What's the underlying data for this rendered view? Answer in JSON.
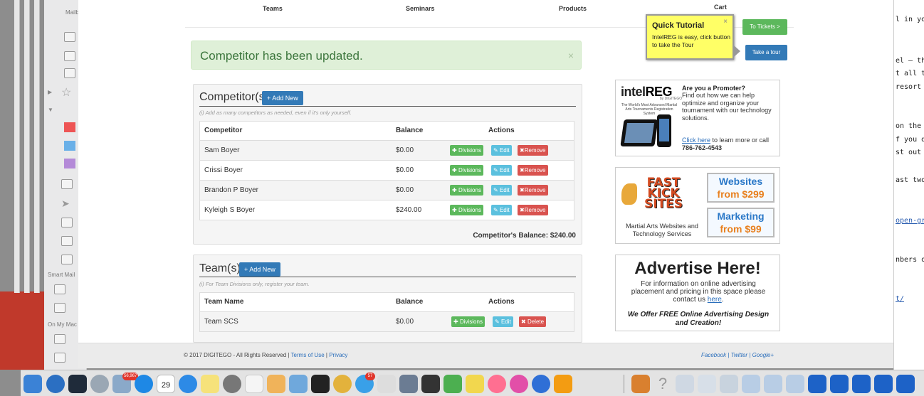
{
  "nav": {
    "items": [
      "Teams",
      "Seminars",
      "Products",
      "Cart"
    ]
  },
  "alert": {
    "message": "Competitor has been updated.",
    "close": "×"
  },
  "competitors": {
    "title": "Competitor(s)",
    "add_label": "+ Add New",
    "hint": "(i) Add as many competitors as needed, even if it's only yourself.",
    "headers": [
      "Competitor",
      "Balance",
      "Actions"
    ],
    "rows": [
      {
        "name": "Sam Boyer",
        "balance": "$0.00"
      },
      {
        "name": "Crissi Boyer",
        "balance": "$0.00"
      },
      {
        "name": "Brandon P Boyer",
        "balance": "$0.00"
      },
      {
        "name": "Kyleigh S Boyer",
        "balance": "$240.00"
      }
    ],
    "actions": {
      "divisions": "Divisions",
      "edit": "Edit",
      "remove": "Remove"
    },
    "total": "Competitor's Balance: $240.00"
  },
  "teams": {
    "title": "Team(s)",
    "add_label": "+ Add New",
    "hint": "(i) For Team Divisions only, register your team.",
    "headers": [
      "Team Name",
      "Balance",
      "Actions"
    ],
    "rows": [
      {
        "name": "Team SCS",
        "balance": "$0.00"
      }
    ],
    "actions": {
      "divisions": "Divisions",
      "edit": "Edit",
      "delete": "Delete"
    }
  },
  "tutorial": {
    "title": "Quick Tutorial",
    "text": "IntelREG is easy, click button to take the Tour",
    "close": "×",
    "tickets_button": "To Tickets >",
    "tour_button": "Take a tour"
  },
  "ad_intelreg": {
    "logo_intel": "intel",
    "logo_reg": "REG",
    "logo_sub": "by DIGITEGO",
    "tagline": "The World's Most Advanced Martial Arts Tournaments Registration System",
    "heading": "Are you a Promoter?",
    "body": "Find out how we can help optimize and organize your tournament with our technology solutions.",
    "link": "Click here",
    "cta_rest": " to learn more or call ",
    "phone": "786-762-4543"
  },
  "ad_fastkick": {
    "logo_lines": "FAST KICK SITES",
    "caption": "Martial Arts Websites and Technology Services",
    "box1_l1": "Websites",
    "box1_l2": "from $299",
    "box2_l1": "Marketing",
    "box2_l2": "from $99"
  },
  "ad_advertise": {
    "headline": "Advertise Here!",
    "text": "For information on online advertising placement and pricing in this space please contact us ",
    "link": "here",
    "offer": "We Offer FREE Online Advertising Design and Creation!"
  },
  "footer": {
    "copyright": "© 2017 DIGITEGO - All Rights Reserved | ",
    "terms": "Terms of Use",
    "sep": " | ",
    "privacy": "Privacy",
    "social": "Facebook | Twitter | Google+"
  },
  "mail_sidebar": {
    "mailboxes": "Mailboxes",
    "smart": "Smart Mail",
    "onmymac": "On My Mac"
  },
  "right_doc_lines": [
    "l in you",
    "el – the",
    "t all the",
    "resort c",
    "on the",
    "f you do",
    "st out",
    "ast two",
    "open-gr",
    "nbers or",
    "t/"
  ],
  "dock": {
    "mail_badge": "56,967",
    "msg_badge": "57",
    "calendar_day": "29"
  },
  "colors": {
    "alert_bg": "#dff0d8",
    "primary": "#337ab7",
    "success": "#5cb85c",
    "info": "#5bc0de",
    "danger": "#d9534f",
    "tutorial_bg": "#ffff66"
  }
}
